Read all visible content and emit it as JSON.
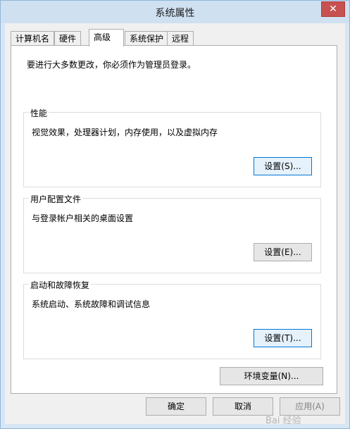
{
  "window": {
    "title": "系统属性",
    "close_label": "✕"
  },
  "tabs": [
    {
      "label": "计算机名"
    },
    {
      "label": "硬件"
    },
    {
      "label": "高级"
    },
    {
      "label": "系统保护"
    },
    {
      "label": "远程"
    }
  ],
  "active_tab": "高级",
  "admin_note": "要进行大多数更改，你必须作为管理员登录。",
  "performance": {
    "legend": "性能",
    "description": "视觉效果，处理器计划，内存使用，以及虚拟内存",
    "button_label": "设置(S)..."
  },
  "user_profiles": {
    "legend": "用户配置文件",
    "description": "与登录帐户相关的桌面设置",
    "button_label": "设置(E)..."
  },
  "startup_recovery": {
    "legend": "启动和故障恢复",
    "description": "系统启动、系统故障和调试信息",
    "button_label": "设置(T)..."
  },
  "env_button_label": "环境变量(N)...",
  "dialog_buttons": {
    "ok": "确定",
    "cancel": "取消",
    "apply": "应用(A)"
  },
  "watermark": "Bai 经验"
}
